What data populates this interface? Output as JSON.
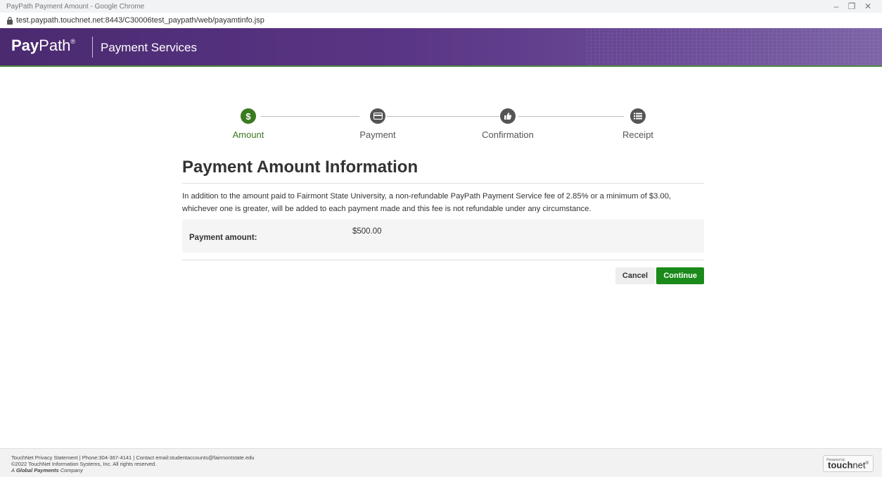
{
  "browser": {
    "window_title": "PayPath Payment Amount - Google Chrome",
    "url": "test.paypath.touchnet.net:8443/C30006test_paypath/web/payamtinfo.jsp",
    "controls": {
      "minimize": "–",
      "restore": "❐",
      "close": "✕"
    }
  },
  "header": {
    "brand_pay": "Pay",
    "brand_path": "Path",
    "brand_mark": "®",
    "service": "Payment Services"
  },
  "steps": [
    {
      "label": "Amount",
      "icon": "dollar-icon",
      "active": true
    },
    {
      "label": "Payment",
      "icon": "credit-card-icon",
      "active": false
    },
    {
      "label": "Confirmation",
      "icon": "thumbs-up-icon",
      "active": false
    },
    {
      "label": "Receipt",
      "icon": "list-icon",
      "active": false
    }
  ],
  "main": {
    "title": "Payment Amount Information",
    "notice": "In addition to the amount paid to Fairmont State University, a non-refundable PayPath Payment Service fee of 2.85% or a minimum of $3.00, whichever one is greater, will be added to each payment made and this fee is not refundable under any circumstance.",
    "amount_label": "Payment amount:",
    "amount_value": "$500.00",
    "cancel_label": "Cancel",
    "continue_label": "Continue"
  },
  "footer": {
    "line1": "TouchNet Privacy Statement  | Phone:304-367-4141 | Contact email:studentaccounts@fairmontstate.edu",
    "line2": "©2022 TouchNet Information Systems, Inc. All rights reserved.",
    "company_prefix": "A ",
    "company_name": "Global Payments",
    "company_suffix": " Company",
    "logo_powered": "Powered by",
    "logo_touch": "touch",
    "logo_net": "net",
    "logo_mark": "®"
  },
  "colors": {
    "header_purple": "#4b2a70",
    "active_green": "#3a7a20",
    "continue_green": "#1a8a1a",
    "inactive_step": "#555555"
  }
}
